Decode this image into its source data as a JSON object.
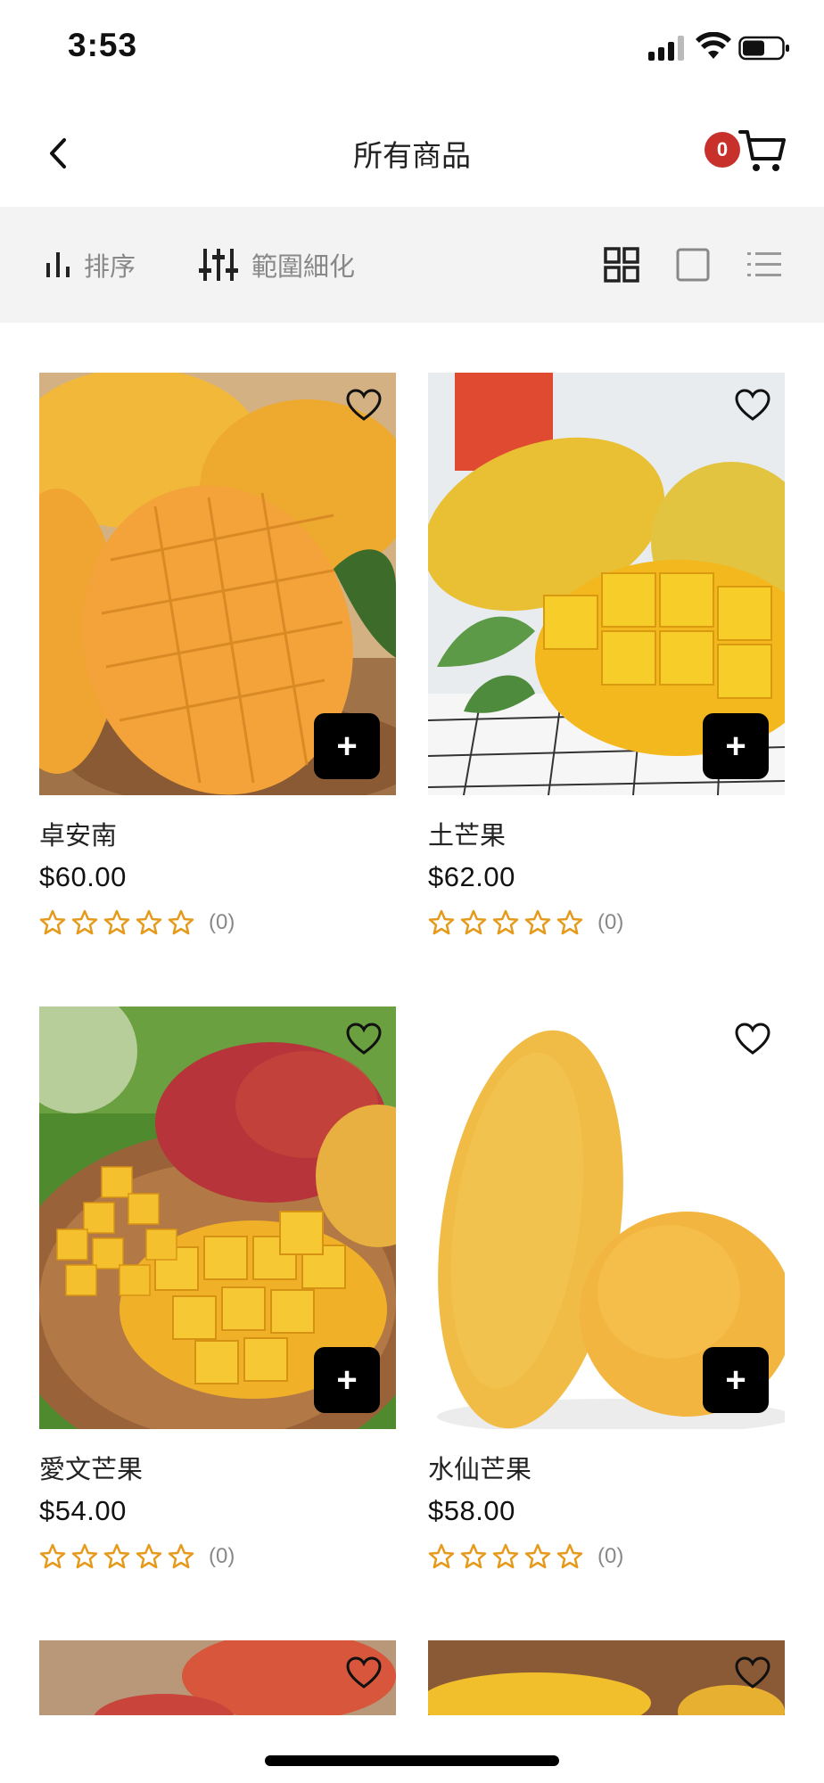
{
  "status_bar": {
    "time": "3:53"
  },
  "header": {
    "title": "所有商品",
    "cart_count": "0",
    "back_icon": "chevron-left-icon",
    "cart_icon": "cart-icon",
    "badge_color": "#c8302c"
  },
  "toolbar": {
    "sort_label": "排序",
    "filter_label": "範圍細化",
    "sort_icon": "bar-chart-icon",
    "filter_icon": "sliders-icon",
    "views": [
      "grid-view-icon",
      "single-view-icon",
      "list-view-icon"
    ],
    "active_view": "grid-view-icon"
  },
  "products": [
    {
      "name": "卓安南",
      "price": "$60.00",
      "reviews": "(0)",
      "stars": 0
    },
    {
      "name": "土芒果",
      "price": "$62.00",
      "reviews": "(0)",
      "stars": 0
    },
    {
      "name": "愛文芒果",
      "price": "$54.00",
      "reviews": "(0)",
      "stars": 0
    },
    {
      "name": "水仙芒果",
      "price": "$58.00",
      "reviews": "(0)",
      "stars": 0
    }
  ],
  "colors": {
    "star": "#e59a1c",
    "toolbar_bg": "#f3f3f3",
    "add_button": "#000000"
  }
}
